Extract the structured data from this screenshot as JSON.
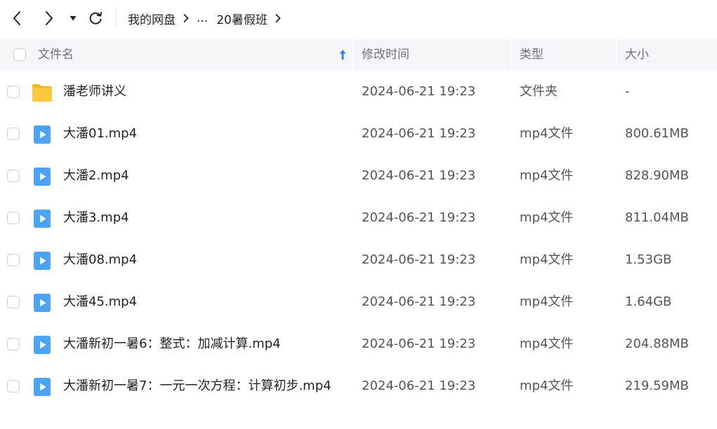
{
  "breadcrumb": {
    "root": "我的网盘",
    "ellipsis": "...",
    "current": "20暑假班"
  },
  "columns": {
    "name": "文件名",
    "modified": "修改时间",
    "type": "类型",
    "size": "大小"
  },
  "colors": {
    "folder": "#fcc83c",
    "video": "#4aa3f5",
    "header_bg": "#f5f6f9",
    "sort_arrow": "#2f7df6"
  },
  "files": [
    {
      "name": "潘老师讲义",
      "modified": "2024-06-21 19:23",
      "type": "文件夹",
      "size": "-",
      "icon": "folder-icon"
    },
    {
      "name": "大潘01.mp4",
      "modified": "2024-06-21 19:23",
      "type": "mp4文件",
      "size": "800.61MB",
      "icon": "video-file-icon"
    },
    {
      "name": "大潘2.mp4",
      "modified": "2024-06-21 19:23",
      "type": "mp4文件",
      "size": "828.90MB",
      "icon": "video-file-icon"
    },
    {
      "name": "大潘3.mp4",
      "modified": "2024-06-21 19:23",
      "type": "mp4文件",
      "size": "811.04MB",
      "icon": "video-file-icon"
    },
    {
      "name": "大潘08.mp4",
      "modified": "2024-06-21 19:23",
      "type": "mp4文件",
      "size": "1.53GB",
      "icon": "video-file-icon"
    },
    {
      "name": "大潘45.mp4",
      "modified": "2024-06-21 19:23",
      "type": "mp4文件",
      "size": "1.64GB",
      "icon": "video-file-icon"
    },
    {
      "name": "大潘新初一暑6：整式：加减计算.mp4",
      "modified": "2024-06-21 19:23",
      "type": "mp4文件",
      "size": "204.88MB",
      "icon": "video-file-icon"
    },
    {
      "name": "大潘新初一暑7：一元一次方程：计算初步.mp4",
      "modified": "2024-06-21 19:23",
      "type": "mp4文件",
      "size": "219.59MB",
      "icon": "video-file-icon"
    }
  ]
}
